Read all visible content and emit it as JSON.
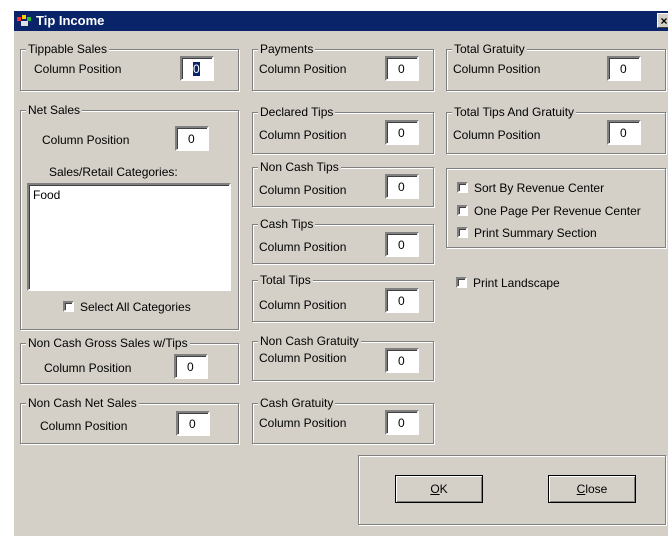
{
  "window": {
    "title": "Tip Income",
    "close_glyph": "×"
  },
  "groups": {
    "tippable_sales": {
      "legend": "Tippable Sales",
      "label": "Column Position",
      "value": "0"
    },
    "net_sales": {
      "legend": "Net Sales",
      "label": "Column Position",
      "value": "0",
      "categories_label": "Sales/Retail Categories:",
      "categories": [
        "Food"
      ],
      "select_all_label": "Select All Categories"
    },
    "non_cash_gross": {
      "legend": "Non Cash Gross Sales w/Tips",
      "label": "Column Position",
      "value": "0"
    },
    "non_cash_net": {
      "legend": "Non Cash Net Sales",
      "label": "Column Position",
      "value": "0"
    },
    "payments": {
      "legend": "Payments",
      "label": "Column Position",
      "value": "0"
    },
    "declared_tips": {
      "legend": "Declared Tips",
      "label": "Column Position",
      "value": "0"
    },
    "non_cash_tips": {
      "legend": "Non Cash Tips",
      "label": "Column Position",
      "value": "0"
    },
    "cash_tips": {
      "legend": "Cash Tips",
      "label": "Column Position",
      "value": "0"
    },
    "total_tips": {
      "legend": "Total Tips",
      "label": "Column Position",
      "value": "0"
    },
    "non_cash_gratuity": {
      "legend": "Non Cash Gratuity",
      "label": "Column Position",
      "value": "0"
    },
    "cash_gratuity": {
      "legend": "Cash Gratuity",
      "label": "Column Position",
      "value": "0"
    },
    "total_gratuity": {
      "legend": "Total Gratuity",
      "label": "Column Position",
      "value": "0"
    },
    "total_tips_gratuity": {
      "legend": "Total Tips And Gratuity",
      "label": "Column Position",
      "value": "0"
    }
  },
  "options": {
    "sort_by_rc": "Sort By Revenue Center",
    "one_page_per_rc": "One Page Per Revenue Center",
    "print_summary": "Print Summary Section",
    "print_landscape": "Print Landscape"
  },
  "buttons": {
    "ok_mnemonic": "O",
    "ok_rest": "K",
    "close_mnemonic": "C",
    "close_rest": "lose"
  },
  "colors": {
    "titlebar": "#0a246a",
    "face": "#d4d0c8"
  }
}
